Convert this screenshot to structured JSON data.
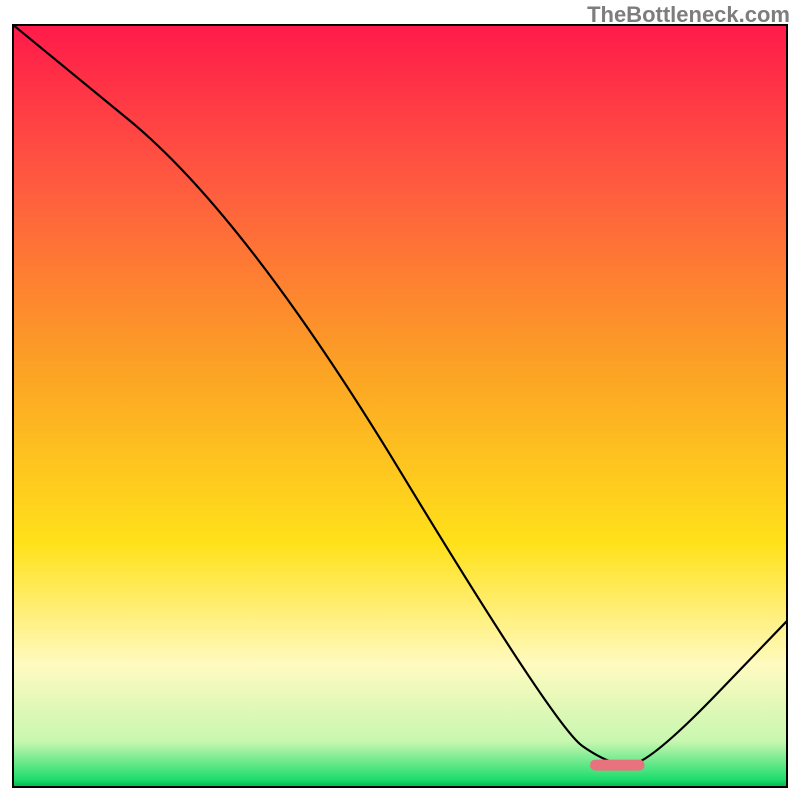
{
  "watermark": "TheBottleneck.com",
  "chart_data": {
    "type": "line",
    "title": "",
    "xlabel": "",
    "ylabel": "",
    "xlim": [
      0,
      100
    ],
    "ylim": [
      0,
      100
    ],
    "grid": false,
    "background": "vertical-gradient red→orange→yellow→pale-yellow→green",
    "series": [
      {
        "name": "bottleneck-curve",
        "x": [
          0,
          30,
          70,
          77,
          82,
          100
        ],
        "values": [
          100,
          75,
          8,
          3,
          3,
          22
        ]
      }
    ],
    "marker": {
      "x_center": 78,
      "y": 3,
      "width_pct": 7
    },
    "gradient_stops": [
      {
        "pct": 0,
        "color": "#ff1a4a"
      },
      {
        "pct": 20,
        "color": "#ff5840"
      },
      {
        "pct": 45,
        "color": "#fca225"
      },
      {
        "pct": 68,
        "color": "#ffe11a"
      },
      {
        "pct": 84,
        "color": "#fffac0"
      },
      {
        "pct": 94,
        "color": "#c8f7b0"
      },
      {
        "pct": 99,
        "color": "#1fdd6e"
      },
      {
        "pct": 100,
        "color": "#00b54c"
      }
    ]
  }
}
